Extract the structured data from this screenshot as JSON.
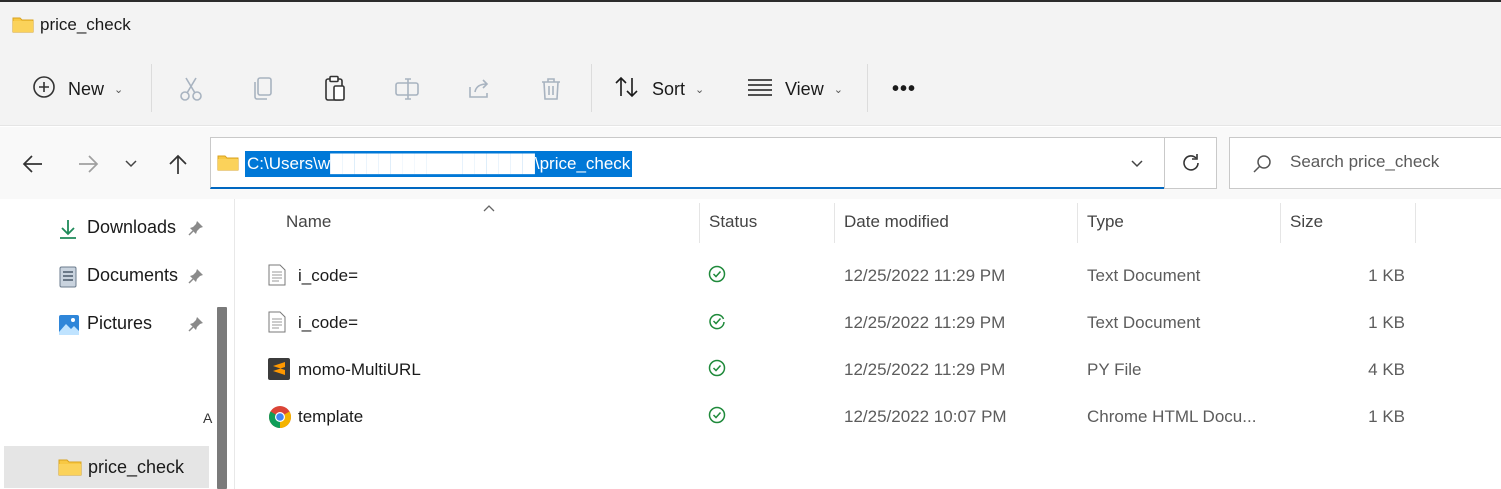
{
  "window": {
    "title": "price_check"
  },
  "toolbar": {
    "new_label": "New",
    "sort_label": "Sort",
    "view_label": "View",
    "more_label": "•••"
  },
  "address": {
    "path_selected": "C:\\Users\\w█████████████████\\price_check",
    "search_placeholder": "Search price_check"
  },
  "sidebar": {
    "items": [
      {
        "label": "Downloads",
        "icon": "download-icon",
        "pinned": true
      },
      {
        "label": "Documents",
        "icon": "documents-icon",
        "pinned": true
      },
      {
        "label": "Pictures",
        "icon": "pictures-icon",
        "pinned": true
      }
    ],
    "stray_text": "A",
    "active_item": {
      "label": "price_check",
      "icon": "folder-icon"
    }
  },
  "columns": {
    "name": "Name",
    "status": "Status",
    "date": "Date modified",
    "type": "Type",
    "size": "Size"
  },
  "files": [
    {
      "name": "i_code=",
      "icon": "text-file-icon",
      "status": "synced",
      "date": "12/25/2022 11:29 PM",
      "type": "Text Document",
      "size": "1 KB"
    },
    {
      "name": "i_code=",
      "icon": "text-file-icon",
      "status": "syncing",
      "date": "12/25/2022 11:29 PM",
      "type": "Text Document",
      "size": "1 KB"
    },
    {
      "name": "momo-MultiURL",
      "icon": "sublime-file-icon",
      "status": "synced",
      "date": "12/25/2022 11:29 PM",
      "type": "PY File",
      "size": "4 KB"
    },
    {
      "name": "template",
      "icon": "chrome-file-icon",
      "status": "synced",
      "date": "12/25/2022 10:07 PM",
      "type": "Chrome HTML Docu...",
      "size": "1 KB"
    }
  ],
  "colors": {
    "accent": "#0078d7",
    "status_green": "#1f8a3b",
    "folder": "#f8c843"
  }
}
